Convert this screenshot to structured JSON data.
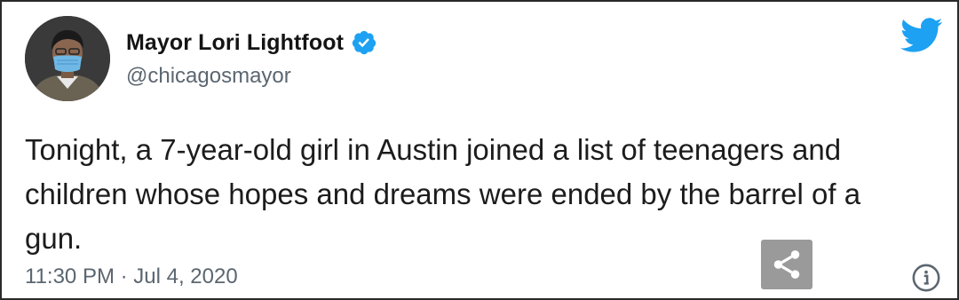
{
  "tweet": {
    "author": {
      "display_name": "Mayor Lori Lightfoot",
      "handle": "@chicagosmayor",
      "verified": true,
      "avatar_icon": "profile-photo"
    },
    "text": "Tonight, a 7-year-old girl in Austin joined a list of teenagers and children whose hopes and dreams were ended by the barrel of a gun.",
    "timestamp": "11:30 PM · Jul 4, 2020"
  },
  "icons": {
    "brand": "twitter-bird-icon",
    "verified": "verified-badge-icon",
    "share": "share-icon",
    "info": "info-icon"
  },
  "colors": {
    "brand_blue": "#1da1f2",
    "text_primary": "#1c1c1c",
    "text_secondary": "#5b6670",
    "share_button_bg": "#9a9a9a",
    "card_border": "#2a2a2a"
  }
}
